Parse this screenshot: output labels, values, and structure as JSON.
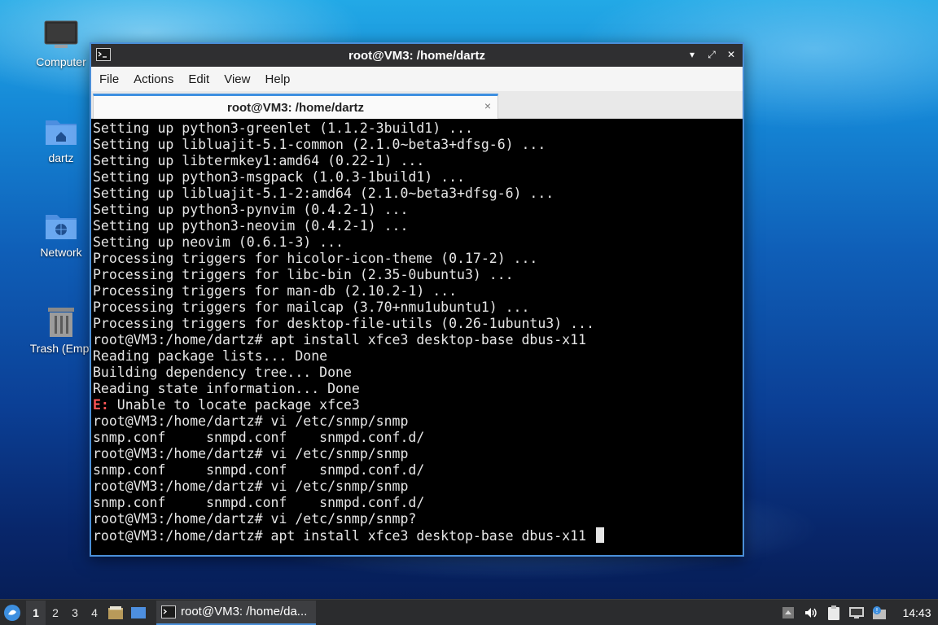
{
  "desktop": {
    "icons": [
      {
        "label": "Computer",
        "icon": "computer-icon"
      },
      {
        "label": "dartz",
        "icon": "home-folder-icon"
      },
      {
        "label": "Network",
        "icon": "network-folder-icon"
      },
      {
        "label": "Trash (Empt",
        "icon": "trash-icon"
      }
    ]
  },
  "window": {
    "title": "root@VM3: /home/dartz",
    "menu": [
      "File",
      "Actions",
      "Edit",
      "View",
      "Help"
    ],
    "tab_label": "root@VM3: /home/dartz",
    "tab_close": "×",
    "controls": {
      "minimize": "▾",
      "maximize": "⤢",
      "close": "✕"
    }
  },
  "terminal": {
    "lines": [
      "Setting up python3-greenlet (1.1.2-3build1) ...",
      "Setting up libluajit-5.1-common (2.1.0~beta3+dfsg-6) ...",
      "Setting up libtermkey1:amd64 (0.22-1) ...",
      "Setting up python3-msgpack (1.0.3-1build1) ...",
      "Setting up libluajit-5.1-2:amd64 (2.1.0~beta3+dfsg-6) ...",
      "Setting up python3-pynvim (0.4.2-1) ...",
      "Setting up python3-neovim (0.4.2-1) ...",
      "Setting up neovim (0.6.1-3) ...",
      "Processing triggers for hicolor-icon-theme (0.17-2) ...",
      "Processing triggers for libc-bin (2.35-0ubuntu3) ...",
      "Processing triggers for man-db (2.10.2-1) ...",
      "Processing triggers for mailcap (3.70+nmu1ubuntu1) ...",
      "Processing triggers for desktop-file-utils (0.26-1ubuntu3) ...",
      "root@VM3:/home/dartz# apt install xfce3 desktop-base dbus-x11",
      "Reading package lists... Done",
      "Building dependency tree... Done",
      "Reading state information... Done"
    ],
    "error_prefix": "E:",
    "error_text": " Unable to locate package xfce3",
    "lines_after": [
      "root@VM3:/home/dartz# vi /etc/snmp/snmp",
      "snmp.conf     snmpd.conf    snmpd.conf.d/",
      "root@VM3:/home/dartz# vi /etc/snmp/snmp",
      "snmp.conf     snmpd.conf    snmpd.conf.d/",
      "root@VM3:/home/dartz# vi /etc/snmp/snmp",
      "snmp.conf     snmpd.conf    snmpd.conf.d/",
      "root@VM3:/home/dartz# vi /etc/snmp/snmp?"
    ],
    "current_prompt": "root@VM3:/home/dartz# apt install xfce3 desktop-base dbus-x11 "
  },
  "taskbar": {
    "workspaces": [
      "1",
      "2",
      "3",
      "4"
    ],
    "active_workspace": "1",
    "task_label": "root@VM3: /home/da...",
    "clock": "14:43"
  },
  "colors": {
    "accent": "#4a8fd8",
    "error": "#ff5555",
    "terminal_bg": "#000000",
    "terminal_fg": "#e6e6e6"
  }
}
